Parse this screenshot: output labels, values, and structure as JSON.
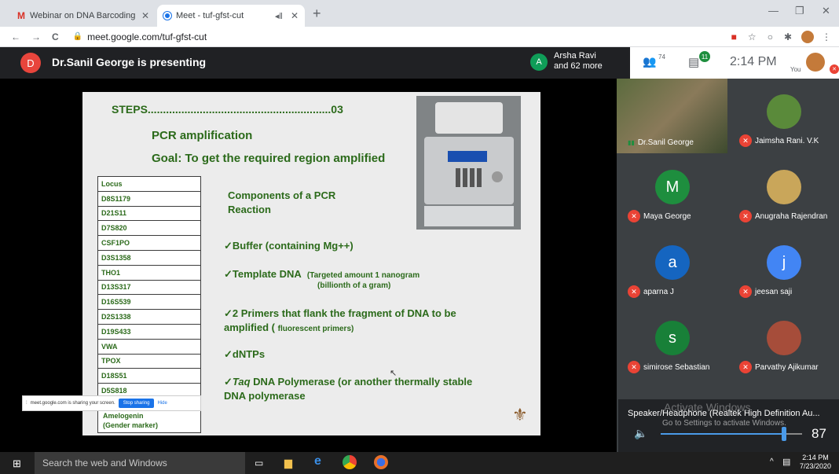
{
  "browser": {
    "tabs": [
      {
        "label": "Webinar on DNA Barcoding and",
        "icon": "gmail-icon"
      },
      {
        "label": "Meet - tuf-gfst-cut",
        "icon": "meet-icon"
      }
    ],
    "url": "meet.google.com/tuf-gfst-cut"
  },
  "meet": {
    "presenter_initial": "D",
    "presenting_text": "Dr.Sanil George is presenting",
    "recent_initial": "A",
    "recent_name": "Arsha Ravi",
    "recent_more": "and 62 more",
    "people_count": "74",
    "chat_badge": "11",
    "time": "2:14 PM",
    "you_label": "You"
  },
  "slide": {
    "steps": "STEPS............................................................03",
    "subtitle": "PCR  amplification",
    "goal": "Goal:  To get the required region amplified",
    "components_title_1": "Components of a PCR",
    "components_title_2": "Reaction",
    "items": [
      "✓Buffer (containing Mg++)",
      "✓Template DNA",
      "(Targeted amount 1 nanogram",
      "(billionth of a gram)",
      "✓2 Primers that flank the fragment of DNA to be",
      "amplified (",
      "fluorescent primers)",
      "✓dNTPs",
      "✓",
      "Taq",
      " DNA Polymerase (or another thermally stable",
      "DNA polymerase"
    ],
    "locus": [
      "Locus",
      "D8S1179",
      "D21S11",
      "D7S820",
      "CSF1PO",
      "D3S1358",
      "THO1",
      "D13S317",
      "D16S539",
      "D2S1338",
      "D19S433",
      "VWA",
      "TPOX",
      "D18S51",
      "D5S818"
    ],
    "amelogenin_1": "Amelogenin",
    "amelogenin_2": "(Gender marker)"
  },
  "participants": [
    {
      "name": "Dr.Sanil George",
      "initial": "",
      "color": "#6b7a4a",
      "muted": false
    },
    {
      "name": "Jaimsha Rani. V.K",
      "initial": "",
      "color": "#5a8a3a",
      "muted": true
    },
    {
      "name": "Maya George",
      "initial": "M",
      "color": "#1e8e3e",
      "muted": true
    },
    {
      "name": "Anugraha Rajendran",
      "initial": "",
      "color": "#c9a65a",
      "muted": true
    },
    {
      "name": "aparna J",
      "initial": "a",
      "color": "#1565c0",
      "muted": true
    },
    {
      "name": "jeesan saji",
      "initial": "j",
      "color": "#4285f4",
      "muted": true
    },
    {
      "name": "simirose Sebastian",
      "initial": "s",
      "color": "#188038",
      "muted": true
    },
    {
      "name": "Parvathy Ajikumar",
      "initial": "",
      "color": "#a64d3a",
      "muted": true
    }
  ],
  "sharing": {
    "text": "meet.google.com is sharing your screen.",
    "stop": "Stop sharing",
    "hide": "Hide"
  },
  "volume": {
    "device": "Speaker/Headphone (Realtek High Definition Au...",
    "watermark_1": "Activate Windows",
    "watermark_2": "Go to Settings to activate Windows.",
    "level": "87",
    "level_fraction": 0.87
  },
  "taskbar": {
    "search_placeholder": "Search the web and Windows",
    "time": "2:14 PM",
    "date": "7/23/2020"
  }
}
